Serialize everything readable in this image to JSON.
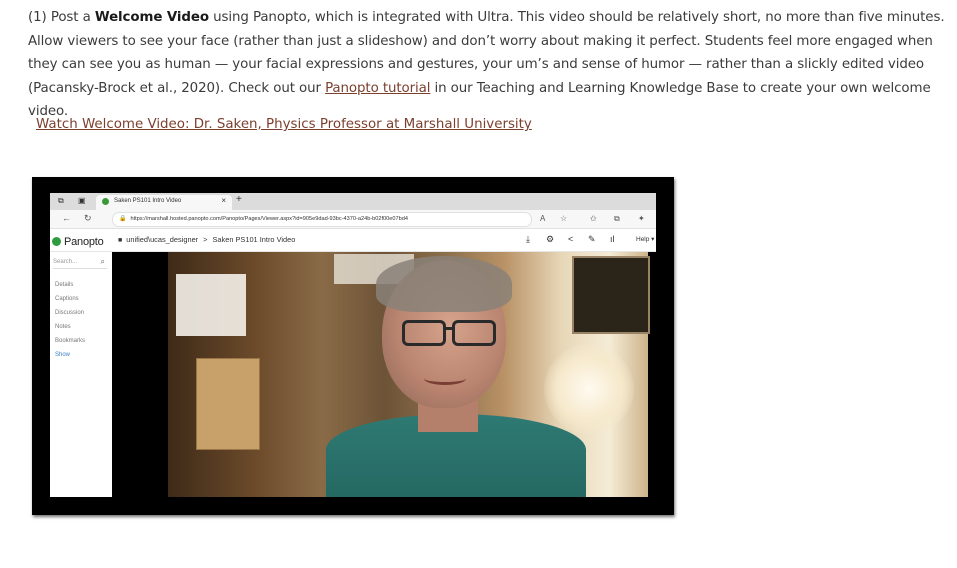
{
  "paragraph": {
    "prefix": "(1) Post a ",
    "bold": "Welcome Video",
    "middle": " using Panopto, which is integrated with Ultra. This video should be relatively short, no more than five minutes. Allow viewers to see your face (rather than just a slideshow) and don’t worry about making it perfect. Students feel more engaged when they can see you as human — your facial expressions and gestures, your um’s and sense of humor — rather than a slickly edited video (Pacansky-Brock et al., 2020). Check out our ",
    "link": "Panopto tutorial",
    "suffix": " in our Teaching and Learning Knowledge Base to create your own welcome video."
  },
  "watch_link": "Watch Welcome Video: Dr. Saken, Physics Professor at Marshall University",
  "embedded": {
    "tab_title": "Saken PS101 Intro Video",
    "tab_close": "×",
    "new_tab": "+",
    "url": "https://marshall.hosted.panopto.com/Panopto/Pages/Viewer.aspx?id=905e9dad-93bc-4370-a24b-b02f00e07bd4",
    "app_name": "Panopto",
    "breadcrumb_folder": "unified\\ucas_designer",
    "breadcrumb_sep": ">",
    "breadcrumb_video": "Saken PS101 Intro Video",
    "help": "Help ▾",
    "search_placeholder": "Search...",
    "sidebar_items": [
      "Details",
      "Captions",
      "Discussion",
      "Notes",
      "Bookmarks",
      "Show"
    ],
    "icons": {
      "back": "←",
      "refresh": "↻",
      "download": "⤓",
      "settings": "⚙",
      "share": "<",
      "edit": "✎",
      "stats": "ıl",
      "star": "☆",
      "read": "A",
      "favorites": "✩",
      "collections": "⧉",
      "extensions": "✦",
      "search": "⌕",
      "lock": "🔒"
    }
  }
}
